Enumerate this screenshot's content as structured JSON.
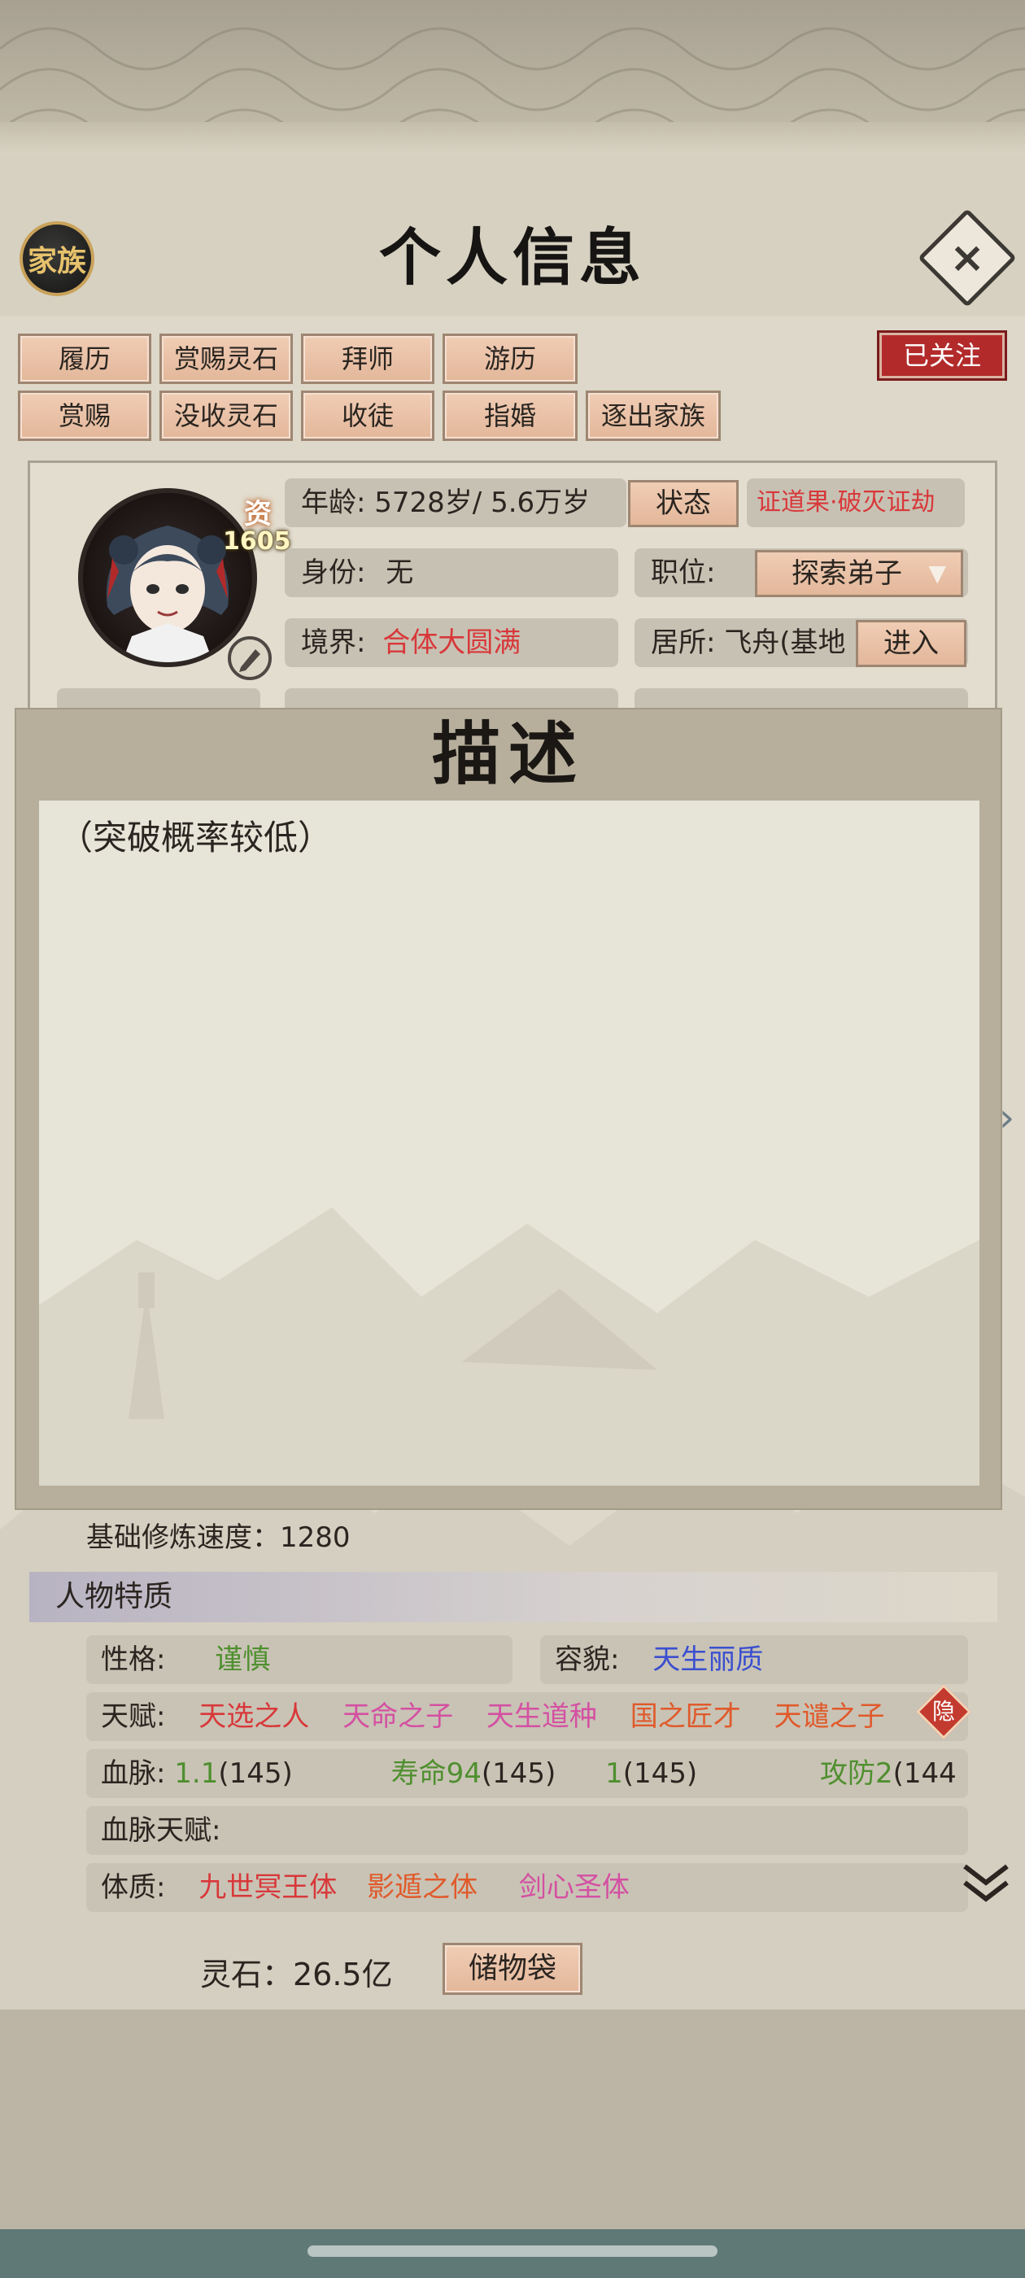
{
  "header": {
    "family_label": "家族",
    "title": "个人信息",
    "close_label": "×"
  },
  "tabs_row1": [
    "履历",
    "赏赐灵石",
    "拜师",
    "游历"
  ],
  "tabs_row2": [
    "赏赐",
    "没收灵石",
    "收徒",
    "指婚",
    "逐出家族"
  ],
  "follow_label": "已关注",
  "profile": {
    "resource_label": "资",
    "resource_value": "1605",
    "age_label": "年龄:",
    "age_value": "5728岁/ 5.6万岁",
    "status_button": "状态",
    "title_red": "证道果·破灭证劫",
    "identity_label": "身份:",
    "identity_value": "无",
    "position_label": "职位:",
    "position_value": "探索弟子",
    "realm_label": "境界:",
    "realm_value": "合体大圆满",
    "residence_label": "居所:",
    "residence_value": "飞舟(基地",
    "enter_button": "进入"
  },
  "description": {
    "title": "描述",
    "text": "（突破概率较低）"
  },
  "base_speed": "基础修炼速度：1280",
  "traits": {
    "section_title": "人物特质",
    "personality_label": "性格:",
    "personality_value": "谨慎",
    "appearance_label": "容貌:",
    "appearance_value": "天生丽质",
    "talent_label": "天赋:",
    "talents": [
      "天选之人",
      "天命之子",
      "天生道种",
      "国之匠才",
      "天谴之子"
    ],
    "hide_label": "隐",
    "bloodline_label": "血脉:",
    "bloodline_a": "1.1",
    "bloodline_a_n": "(145)",
    "bloodline_b": "寿命94",
    "bloodline_b_n": "(145)",
    "bloodline_c": "1",
    "bloodline_c_n": "(145)",
    "bloodline_d": "攻防2",
    "bloodline_d_n": "(144",
    "bloodline_talent_label": "血脉天赋:",
    "physique_label": "体质:",
    "physiques": [
      "九世冥王体",
      "影遁之体",
      "剑心圣体"
    ]
  },
  "footer": {
    "lingshi": "灵石：26.5亿",
    "bag_button": "储物袋"
  }
}
